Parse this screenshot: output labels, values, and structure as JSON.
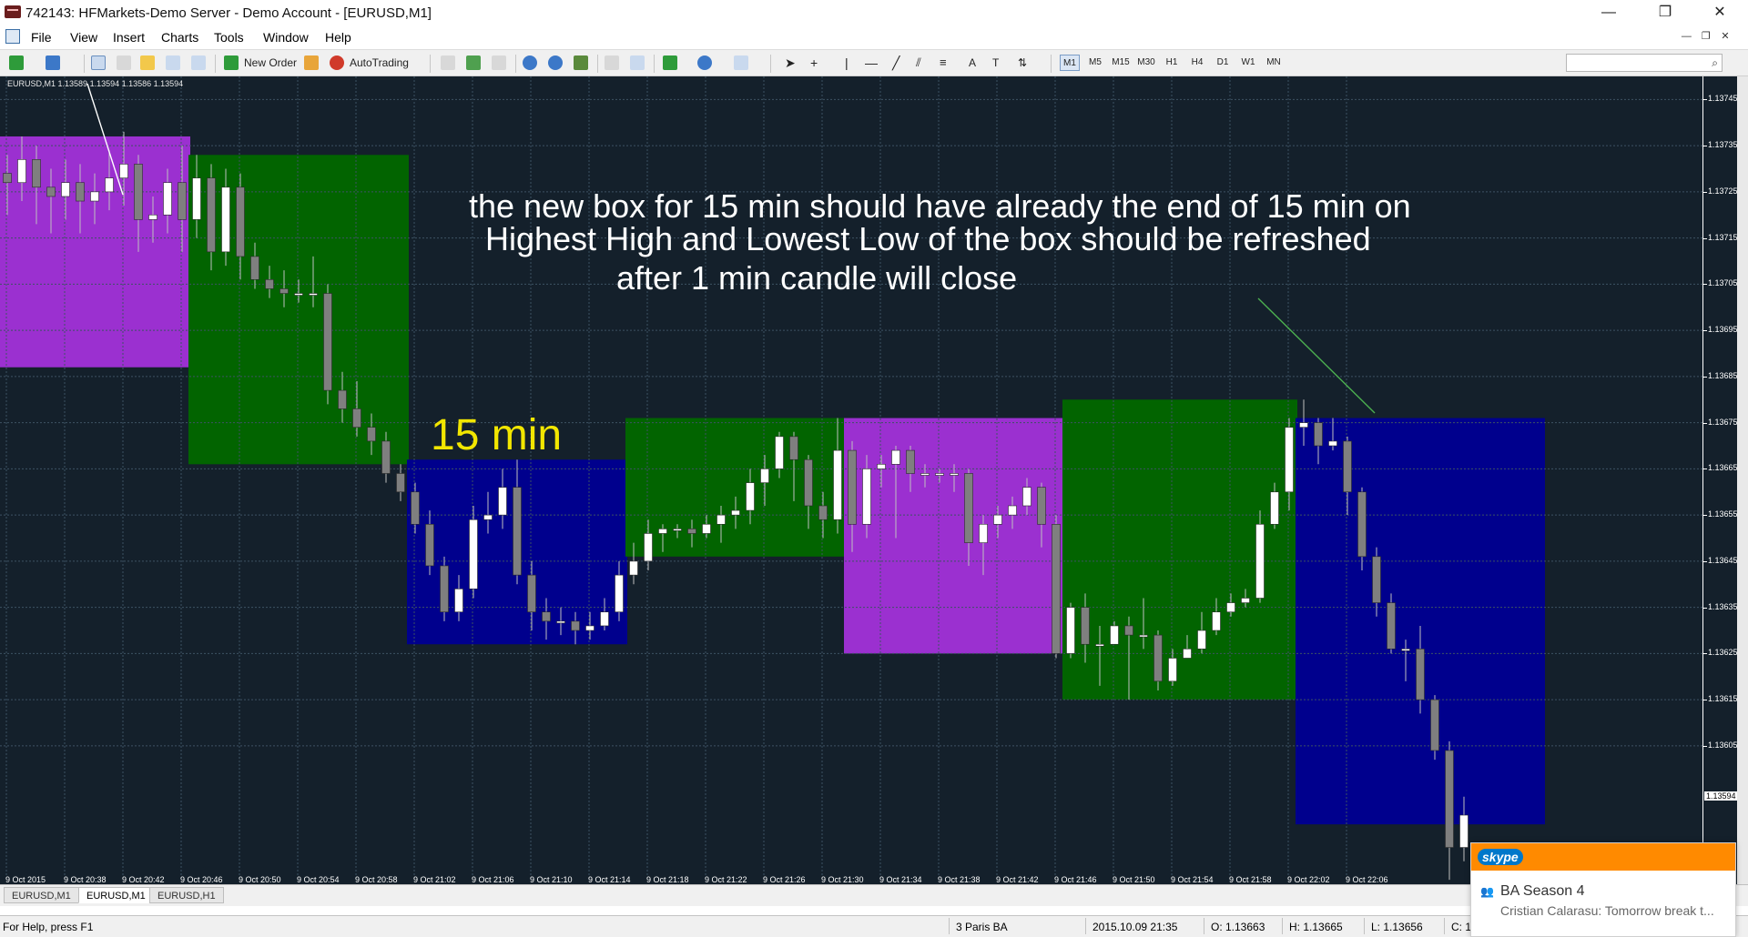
{
  "window": {
    "title": "742143: HFMarkets-Demo Server - Demo Account - [EURUSD,M1]",
    "controls": {
      "minimize": "—",
      "restore": "❐",
      "close": "✕"
    }
  },
  "menu": {
    "items": [
      "File",
      "View",
      "Insert",
      "Charts",
      "Tools",
      "Window",
      "Help"
    ]
  },
  "toolbar": {
    "new_order": "New Order",
    "autotrading": "AutoTrading",
    "timeframes": [
      "M1",
      "M5",
      "M15",
      "M30",
      "H1",
      "H4",
      "D1",
      "W1",
      "MN"
    ],
    "active_timeframe": "M1",
    "search_placeholder": ""
  },
  "chart": {
    "symbol_label": "EURUSD,M1",
    "ohlc": "1.13589 1.13594 1.13586 1.13594",
    "annotation_lines": [
      "the new box for 15 min should have already the end of 15 min on",
      "Highest High and Lowest Low of the box should be refreshed",
      "after 1 min candle will close"
    ],
    "box_label": "15 min",
    "current_price": "1.13594",
    "colors": {
      "background": "#14202b",
      "purple": "#9b30d0",
      "green": "#026400",
      "blue": "#00008d",
      "annotation": "#ffffff",
      "box_label": "#f2e600"
    }
  },
  "chart_data": {
    "type": "candlestick",
    "symbol": "EURUSD",
    "timeframe": "M1",
    "y_ticks": [
      "1.13745",
      "1.13735",
      "1.13725",
      "1.13715",
      "1.13705",
      "1.13695",
      "1.13685",
      "1.13675",
      "1.13665",
      "1.13655",
      "1.13645",
      "1.13635",
      "1.13625",
      "1.13615",
      "1.13605"
    ],
    "ylim": [
      1.13577,
      1.1375
    ],
    "x_ticks": [
      "9 Oct 2015",
      "9 Oct 20:38",
      "9 Oct 20:42",
      "9 Oct 20:46",
      "9 Oct 20:50",
      "9 Oct 20:54",
      "9 Oct 20:58",
      "9 Oct 21:02",
      "9 Oct 21:06",
      "9 Oct 21:10",
      "9 Oct 21:14",
      "9 Oct 21:18",
      "9 Oct 21:22",
      "9 Oct 21:26",
      "9 Oct 21:30",
      "9 Oct 21:34",
      "9 Oct 21:38",
      "9 Oct 21:42",
      "9 Oct 21:46",
      "9 Oct 21:50",
      "9 Oct 21:54",
      "9 Oct 21:58",
      "9 Oct 22:02",
      "9 Oct 22:06"
    ],
    "boxes": [
      {
        "color": "purple",
        "i0": 0,
        "i1": 12,
        "high": 1.13737,
        "low": 1.13687
      },
      {
        "color": "green",
        "i0": 13,
        "i1": 27,
        "high": 1.13733,
        "low": 1.13666
      },
      {
        "color": "blue",
        "i0": 28,
        "i1": 42,
        "high": 1.13667,
        "low": 1.13627
      },
      {
        "color": "green",
        "i0": 43,
        "i1": 57,
        "high": 1.13676,
        "low": 1.13646
      },
      {
        "color": "purple",
        "i0": 58,
        "i1": 72,
        "high": 1.13676,
        "low": 1.13625
      },
      {
        "color": "green",
        "i0": 73,
        "i1": 88,
        "high": 1.1368,
        "low": 1.13615
      },
      {
        "color": "blue",
        "i0": 89,
        "i1": 105,
        "high": 1.13676,
        "low": 1.13588
      }
    ],
    "candles": [
      [
        1.13729,
        1.13727,
        1.13733,
        1.1372
      ],
      [
        1.13727,
        1.13732,
        1.13737,
        1.13723
      ],
      [
        1.13732,
        1.13726,
        1.13735,
        1.13718
      ],
      [
        1.13726,
        1.13724,
        1.1373,
        1.13716
      ],
      [
        1.13724,
        1.13727,
        1.13732,
        1.13719
      ],
      [
        1.13727,
        1.13723,
        1.13731,
        1.13716
      ],
      [
        1.13723,
        1.13725,
        1.13729,
        1.13718
      ],
      [
        1.13725,
        1.13728,
        1.13734,
        1.13721
      ],
      [
        1.13728,
        1.13731,
        1.13738,
        1.13722
      ],
      [
        1.13731,
        1.13719,
        1.13733,
        1.13712
      ],
      [
        1.13719,
        1.1372,
        1.13724,
        1.13714
      ],
      [
        1.1372,
        1.13727,
        1.1373,
        1.13716
      ],
      [
        1.13727,
        1.13719,
        1.13735,
        1.13712
      ],
      [
        1.13719,
        1.13728,
        1.13733,
        1.13715
      ],
      [
        1.13728,
        1.13712,
        1.13731,
        1.13708
      ],
      [
        1.13712,
        1.13726,
        1.1373,
        1.13709
      ],
      [
        1.13726,
        1.13711,
        1.13729,
        1.13706
      ],
      [
        1.13711,
        1.13706,
        1.13714,
        1.13704
      ],
      [
        1.13706,
        1.13704,
        1.13709,
        1.13702
      ],
      [
        1.13704,
        1.13703,
        1.13708,
        1.137
      ],
      [
        1.13703,
        1.13703,
        1.13706,
        1.13701
      ],
      [
        1.13703,
        1.13703,
        1.13711,
        1.137
      ],
      [
        1.13703,
        1.13682,
        1.13705,
        1.13679
      ],
      [
        1.13682,
        1.13678,
        1.13686,
        1.13675
      ],
      [
        1.13678,
        1.13674,
        1.13684,
        1.13672
      ],
      [
        1.13674,
        1.13671,
        1.13677,
        1.13668
      ],
      [
        1.13671,
        1.13664,
        1.13673,
        1.13662
      ],
      [
        1.13664,
        1.1366,
        1.13666,
        1.13658
      ],
      [
        1.1366,
        1.13653,
        1.13662,
        1.13651
      ],
      [
        1.13653,
        1.13644,
        1.13656,
        1.13642
      ],
      [
        1.13644,
        1.13634,
        1.13646,
        1.13632
      ],
      [
        1.13634,
        1.13639,
        1.13642,
        1.13632
      ],
      [
        1.13639,
        1.13654,
        1.13657,
        1.13637
      ],
      [
        1.13654,
        1.13655,
        1.1366,
        1.13651
      ],
      [
        1.13655,
        1.13661,
        1.13665,
        1.13652
      ],
      [
        1.13661,
        1.13642,
        1.13667,
        1.1364
      ],
      [
        1.13642,
        1.13634,
        1.13645,
        1.1363
      ],
      [
        1.13634,
        1.13632,
        1.13637,
        1.13628
      ],
      [
        1.13632,
        1.13632,
        1.13635,
        1.13629
      ],
      [
        1.13632,
        1.1363,
        1.13634,
        1.13627
      ],
      [
        1.1363,
        1.13631,
        1.13634,
        1.13628
      ],
      [
        1.13631,
        1.13634,
        1.13637,
        1.1363
      ],
      [
        1.13634,
        1.13642,
        1.13645,
        1.13632
      ],
      [
        1.13642,
        1.13645,
        1.13649,
        1.1364
      ],
      [
        1.13645,
        1.13651,
        1.13654,
        1.13643
      ],
      [
        1.13651,
        1.13652,
        1.13653,
        1.13647
      ],
      [
        1.13652,
        1.13652,
        1.13653,
        1.1365
      ],
      [
        1.13652,
        1.13651,
        1.13654,
        1.13648
      ],
      [
        1.13651,
        1.13653,
        1.13655,
        1.1365
      ],
      [
        1.13653,
        1.13655,
        1.13657,
        1.13649
      ],
      [
        1.13655,
        1.13656,
        1.13659,
        1.13652
      ],
      [
        1.13656,
        1.13662,
        1.13665,
        1.13653
      ],
      [
        1.13662,
        1.13665,
        1.13668,
        1.13657
      ],
      [
        1.13665,
        1.13672,
        1.13673,
        1.13663
      ],
      [
        1.13672,
        1.13667,
        1.13673,
        1.13658
      ],
      [
        1.13667,
        1.13657,
        1.13668,
        1.13652
      ],
      [
        1.13657,
        1.13654,
        1.1366,
        1.1365
      ],
      [
        1.13654,
        1.13669,
        1.13676,
        1.13651
      ],
      [
        1.13669,
        1.13653,
        1.13671,
        1.13647
      ],
      [
        1.13653,
        1.13665,
        1.13668,
        1.1365
      ],
      [
        1.13665,
        1.13666,
        1.13668,
        1.13661
      ],
      [
        1.13666,
        1.13669,
        1.1367,
        1.1365
      ],
      [
        1.13669,
        1.13664,
        1.1367,
        1.1366
      ],
      [
        1.13664,
        1.13664,
        1.13666,
        1.13661
      ],
      [
        1.13664,
        1.13664,
        1.13665,
        1.13662
      ],
      [
        1.13664,
        1.13664,
        1.13666,
        1.1366
      ],
      [
        1.13664,
        1.13649,
        1.13665,
        1.13644
      ],
      [
        1.13649,
        1.13653,
        1.13655,
        1.13642
      ],
      [
        1.13653,
        1.13655,
        1.13657,
        1.1365
      ],
      [
        1.13655,
        1.13657,
        1.13659,
        1.13652
      ],
      [
        1.13657,
        1.13661,
        1.13663,
        1.13655
      ],
      [
        1.13661,
        1.13653,
        1.13662,
        1.13648
      ],
      [
        1.13653,
        1.13625,
        1.13655,
        1.13624
      ],
      [
        1.13625,
        1.13635,
        1.13636,
        1.13624
      ],
      [
        1.13635,
        1.13627,
        1.13638,
        1.13623
      ],
      [
        1.13627,
        1.13627,
        1.13631,
        1.13618
      ],
      [
        1.13627,
        1.13631,
        1.13632,
        1.13627
      ],
      [
        1.13631,
        1.13629,
        1.13633,
        1.13615
      ],
      [
        1.13629,
        1.13629,
        1.13637,
        1.13626
      ],
      [
        1.13629,
        1.13619,
        1.1363,
        1.13617
      ],
      [
        1.13619,
        1.13624,
        1.13626,
        1.13618
      ],
      [
        1.13624,
        1.13626,
        1.13629,
        1.13624
      ],
      [
        1.13626,
        1.1363,
        1.13634,
        1.13625
      ],
      [
        1.1363,
        1.13634,
        1.13637,
        1.13629
      ],
      [
        1.13634,
        1.13636,
        1.13638,
        1.13633
      ],
      [
        1.13636,
        1.13637,
        1.13639,
        1.13635
      ],
      [
        1.13637,
        1.13653,
        1.13656,
        1.13636
      ],
      [
        1.13653,
        1.1366,
        1.13662,
        1.13652
      ],
      [
        1.1366,
        1.13674,
        1.13676,
        1.13656
      ],
      [
        1.13674,
        1.13675,
        1.1368,
        1.1367
      ],
      [
        1.13675,
        1.1367,
        1.13676,
        1.13666
      ],
      [
        1.1367,
        1.13671,
        1.13676,
        1.13669
      ],
      [
        1.13671,
        1.1366,
        1.13672,
        1.13655
      ],
      [
        1.1366,
        1.13646,
        1.13661,
        1.13643
      ],
      [
        1.13646,
        1.13636,
        1.13648,
        1.13633
      ],
      [
        1.13636,
        1.13626,
        1.13638,
        1.13625
      ],
      [
        1.13626,
        1.13626,
        1.13628,
        1.13619
      ],
      [
        1.13626,
        1.13615,
        1.13631,
        1.13612
      ],
      [
        1.13615,
        1.13604,
        1.13616,
        1.13602
      ],
      [
        1.13604,
        1.13583,
        1.13606,
        1.13576
      ],
      [
        1.13583,
        1.1359,
        1.13594,
        1.1358
      ]
    ],
    "grid": true
  },
  "tabs": [
    {
      "label": "EURUSD,M1",
      "active": false
    },
    {
      "label": "EURUSD,M1",
      "active": true
    },
    {
      "label": "EURUSD,H1",
      "active": false
    }
  ],
  "status": {
    "help": "For Help, press F1",
    "profile": "3 Paris BA",
    "datetime": "2015.10.09 21:35",
    "open": "O: 1.13663",
    "high": "H: 1.13665",
    "low": "L: 1.13656",
    "close": "C: 1"
  },
  "skype": {
    "logo": "skype",
    "title": "BA Season 4",
    "message": "Cristian Calarasu: Tomorrow break t..."
  }
}
